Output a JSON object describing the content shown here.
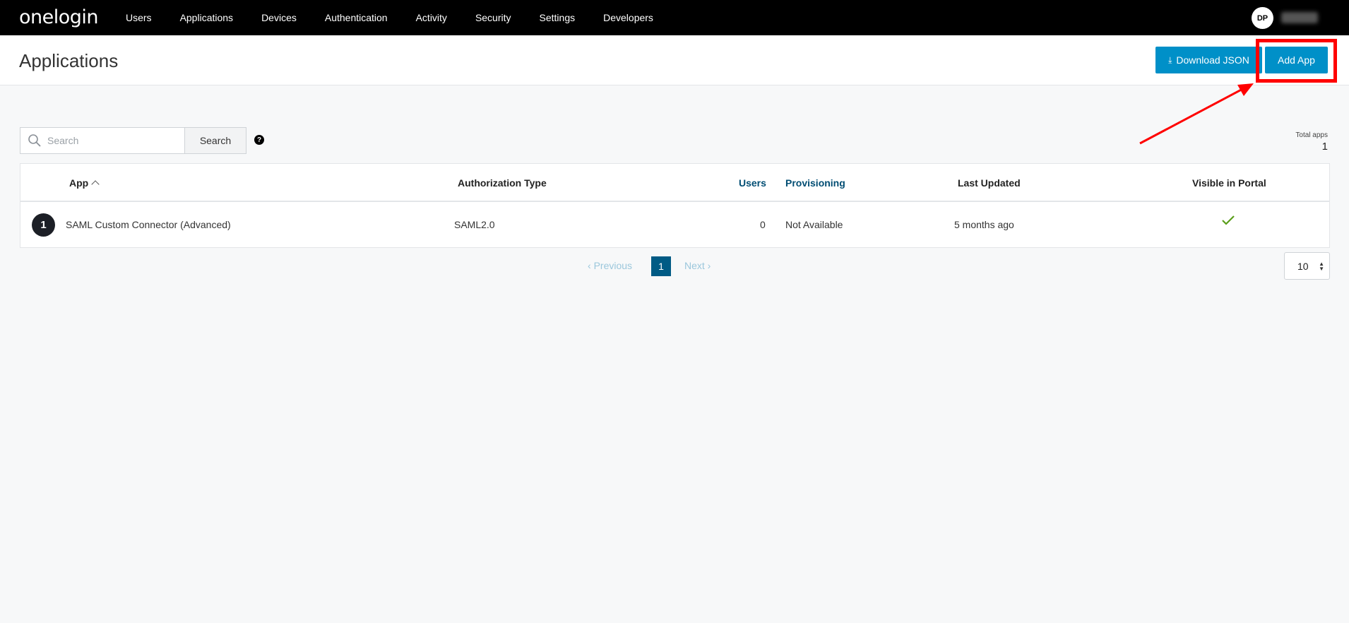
{
  "brand": {
    "logo_text": "onelogin"
  },
  "nav": {
    "items": [
      {
        "label": "Users"
      },
      {
        "label": "Applications"
      },
      {
        "label": "Devices"
      },
      {
        "label": "Authentication"
      },
      {
        "label": "Activity"
      },
      {
        "label": "Security"
      },
      {
        "label": "Settings"
      },
      {
        "label": "Developers"
      }
    ],
    "avatar_initials": "DP"
  },
  "header": {
    "title": "Applications",
    "download_label": "Download JSON",
    "download_icon": "download-icon",
    "add_label": "Add App"
  },
  "search": {
    "placeholder": "Search",
    "button_label": "Search",
    "help_label": "?",
    "total_label": "Total apps",
    "total_count": "1"
  },
  "table": {
    "columns": {
      "app": "App",
      "auth_type": "Authorization Type",
      "users": "Users",
      "provisioning": "Provisioning",
      "last_updated": "Last Updated",
      "visible": "Visible in Portal"
    },
    "rows": [
      {
        "icon_glyph": "1",
        "name": "SAML Custom Connector (Advanced)",
        "auth_type": "SAML2.0",
        "users": "0",
        "provisioning": "Not Available",
        "last_updated": "5 months ago",
        "visible_in_portal": true
      }
    ]
  },
  "pagination": {
    "previous_label": "Previous",
    "current_page": "1",
    "next_label": "Next",
    "per_page": "10"
  },
  "colors": {
    "nav_bg": "#000000",
    "primary_button": "#0090c8",
    "current_page": "#005b85",
    "highlight": "#ff0000",
    "check": "#5a9e1a"
  }
}
